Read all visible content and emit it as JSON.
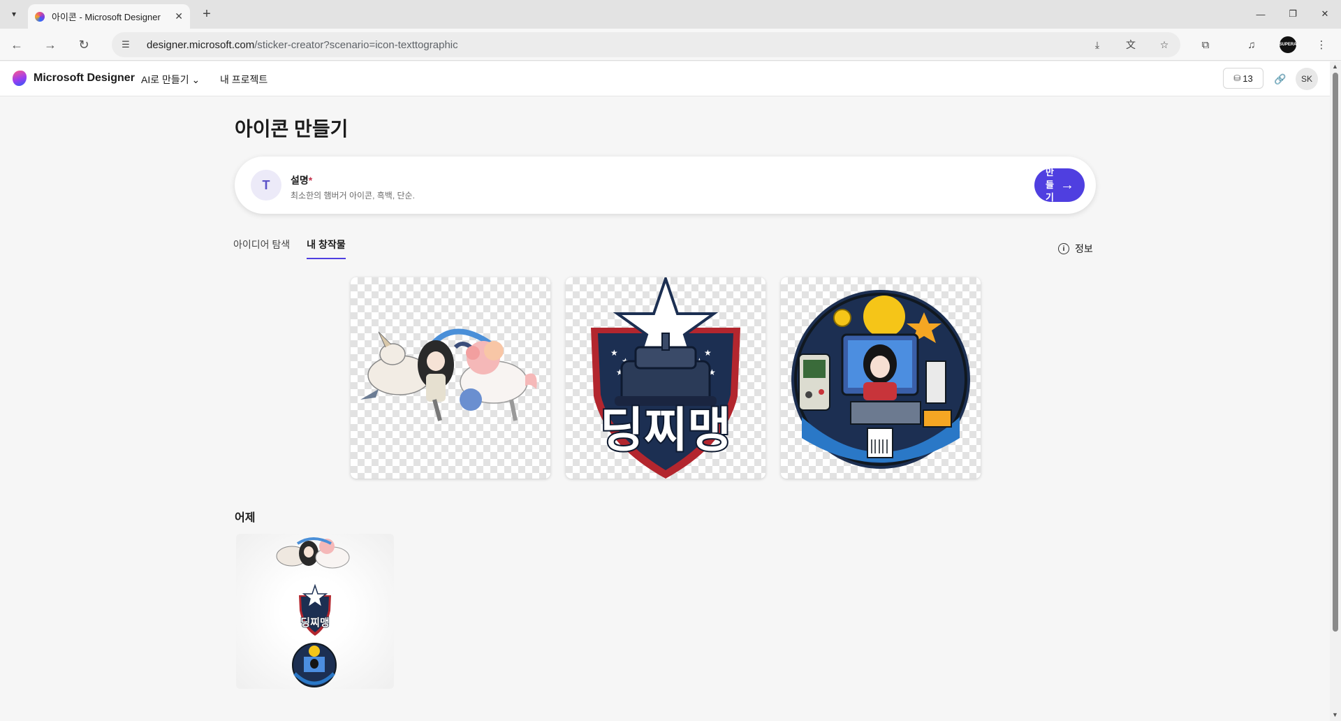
{
  "browser": {
    "tab_title": "아이콘 - Microsoft Designer",
    "url_host": "designer.microsoft.com",
    "url_path": "/sticker-creator?scenario=icon-texttographic",
    "profile_label": "SUPERA"
  },
  "header": {
    "brand": "Microsoft Designer",
    "nav": {
      "ai_create": "AI로 만들기",
      "my_projects": "내 프로젝트"
    },
    "credits": "13",
    "avatar": "SK"
  },
  "main": {
    "title": "아이콘 만들기",
    "prompt": {
      "label": "설명",
      "required_mark": "*",
      "placeholder": "최소한의 햄버거 아이콘, 흑백, 단순.",
      "create_button": "만들기"
    },
    "tabs": [
      {
        "label": "아이디어 탐색",
        "active": false
      },
      {
        "label": "내 창작물",
        "active": true
      }
    ],
    "info_link": "정보",
    "thumbnails": [
      {
        "name": "unicorn-girl-sticker",
        "text": ""
      },
      {
        "name": "star-tank-emblem",
        "text": "딩찌맹"
      },
      {
        "name": "retro-gamer-girl-badge",
        "text": ""
      }
    ],
    "history": {
      "section_title": "어제",
      "text": "딩찌맹"
    }
  },
  "colors": {
    "accent": "#4f3fe0",
    "navy": "#1c2f52",
    "red": "#b3262e",
    "yellow": "#f5c518"
  }
}
